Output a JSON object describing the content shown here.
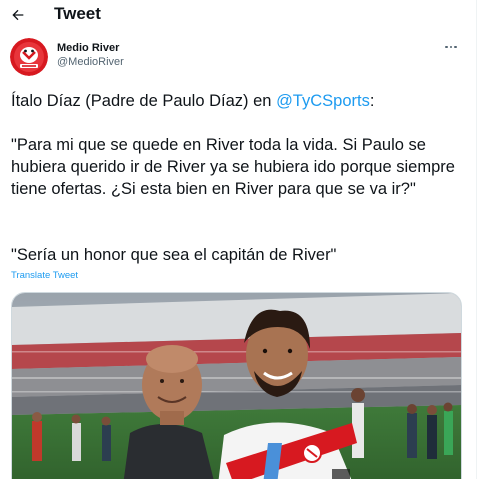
{
  "header": {
    "title": "Tweet"
  },
  "author": {
    "display_name": "Medio River",
    "handle": "@MedioRiver"
  },
  "tweet": {
    "para1_prefix": "Ítalo Díaz (Padre de Paulo Díaz) en ",
    "mention": "@TyCSports",
    "para1_suffix": ":",
    "para2": "\"Para mi que se quede en River toda la vida. Si Paulo se hubiera querido ir de River ya se hubiera ido porque siempre tiene ofertas. ¿Si esta bien en River para que se va ir?\"",
    "para3": "\"Sería un honor que sea el capitán de River\"",
    "translate_label": "Translate Tweet"
  },
  "colors": {
    "accent": "#1d9bf0",
    "text": "#0f1419",
    "secondary": "#536471",
    "river_red": "#d71920"
  }
}
